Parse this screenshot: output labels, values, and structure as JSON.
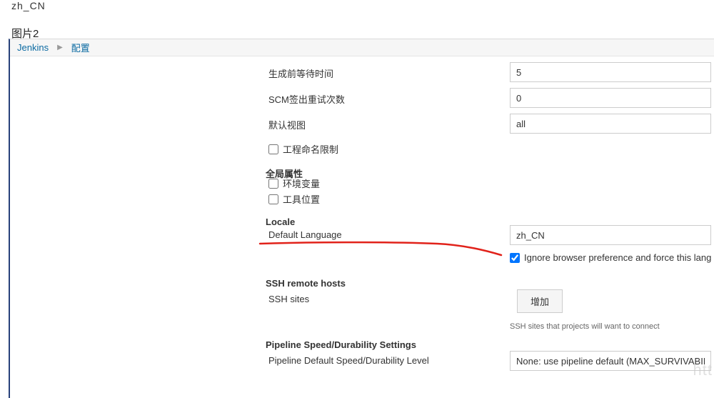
{
  "top_fragment": "zh_CN",
  "caption": "图片2",
  "breadcrumb": {
    "root": "Jenkins",
    "current": "配置"
  },
  "form": {
    "wait_label": "生成前等待时间",
    "wait_value": "5",
    "scm_label": "SCM签出重试次数",
    "scm_value": "0",
    "default_view_label": "默认视图",
    "default_view_value": "all",
    "naming_cb": "工程命名限制",
    "global_heading": "全局属性",
    "env_cb": "环境变量",
    "tool_cb": "工具位置",
    "locale_heading": "Locale",
    "lang_label": "Default Language",
    "lang_value": "zh_CN",
    "ignore_cb": "Ignore browser preference and force this lang",
    "ssh_heading": "SSH remote hosts",
    "ssh_sites_label": "SSH sites",
    "add_btn": "增加",
    "ssh_helper": "SSH sites that projects will want to connect",
    "pipeline_heading": "Pipeline Speed/Durability Settings",
    "pipeline_label": "Pipeline Default Speed/Durability Level",
    "pipeline_value": "None: use pipeline default (MAX_SURVIVABILI"
  },
  "watermark": "htt"
}
